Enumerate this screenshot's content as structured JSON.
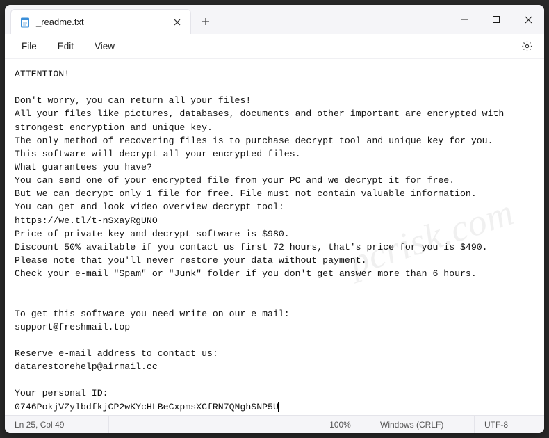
{
  "titlebar": {
    "tab_title": "_readme.txt"
  },
  "menubar": {
    "file": "File",
    "edit": "Edit",
    "view": "View"
  },
  "document": {
    "text": "ATTENTION!\n\nDon't worry, you can return all your files!\nAll your files like pictures, databases, documents and other important are encrypted with strongest encryption and unique key.\nThe only method of recovering files is to purchase decrypt tool and unique key for you.\nThis software will decrypt all your encrypted files.\nWhat guarantees you have?\nYou can send one of your encrypted file from your PC and we decrypt it for free.\nBut we can decrypt only 1 file for free. File must not contain valuable information.\nYou can get and look video overview decrypt tool:\nhttps://we.tl/t-nSxayRgUNO\nPrice of private key and decrypt software is $980.\nDiscount 50% available if you contact us first 72 hours, that's price for you is $490.\nPlease note that you'll never restore your data without payment.\nCheck your e-mail \"Spam\" or \"Junk\" folder if you don't get answer more than 6 hours.\n\n\nTo get this software you need write on our e-mail:\nsupport@freshmail.top\n\nReserve e-mail address to contact us:\ndatarestorehelp@airmail.cc\n\nYour personal ID:\n0746PokjVZylbdfkjCP2wKYcHLBeCxpmsXCfRN7QNghSNP5U"
  },
  "statusbar": {
    "position": "Ln 25, Col 49",
    "zoom": "100%",
    "line_ending": "Windows (CRLF)",
    "encoding": "UTF-8"
  },
  "watermark": "pcrisk.com"
}
